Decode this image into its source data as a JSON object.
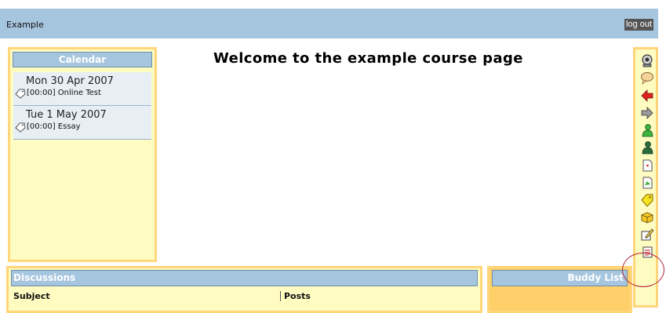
{
  "header": {
    "site_title": "Example",
    "logout_label": "log out"
  },
  "page": {
    "title": "Welcome to the example course page"
  },
  "calendar": {
    "title": "Calendar",
    "events": [
      {
        "date": "Mon 30 Apr 2007",
        "item": "[00:00] Online Test"
      },
      {
        "date": "Tue 1 May 2007",
        "item": "[00:00] Essay"
      }
    ]
  },
  "discussions": {
    "title": "Discussions",
    "columns": {
      "subject": "Subject",
      "posts": "Posts"
    }
  },
  "buddy_list": {
    "title": "Buddy List"
  },
  "toolbar": {
    "icons": [
      "webcam-icon",
      "speech-bubble-icon",
      "red-arrow-icon",
      "grey-arrow-icon",
      "green-user-icon",
      "dark-green-user-icon",
      "document-icon",
      "green-document-icon",
      "yellow-tag-icon",
      "box-icon",
      "edit-icon",
      "notepad-icon"
    ],
    "highlight_color": "#b0243b"
  },
  "colors": {
    "header_blue": "#a6c5df",
    "panel_bg": "#fffcc2",
    "panel_border": "#ffd67a"
  }
}
